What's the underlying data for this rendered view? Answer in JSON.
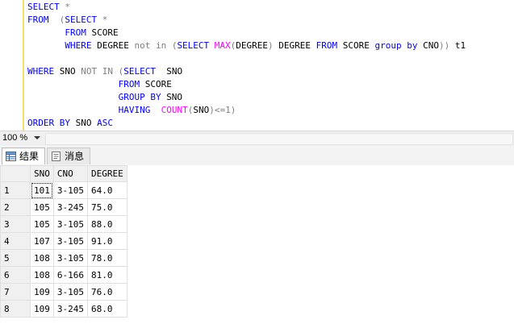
{
  "editor": {
    "lines": [
      [
        {
          "t": "SELECT ",
          "c": "kw"
        },
        {
          "t": "*",
          "c": "op"
        }
      ],
      [
        {
          "t": "FROM  ",
          "c": "kw"
        },
        {
          "t": "(",
          "c": "op"
        },
        {
          "t": "SELECT ",
          "c": "kw"
        },
        {
          "t": "*",
          "c": "op"
        }
      ],
      [
        {
          "t": "       FROM ",
          "c": "kw"
        },
        {
          "t": "SCORE",
          "c": "str"
        }
      ],
      [
        {
          "t": "       WHERE ",
          "c": "kw"
        },
        {
          "t": "DEGREE ",
          "c": "str"
        },
        {
          "t": "not in ",
          "c": "op"
        },
        {
          "t": "(",
          "c": "op"
        },
        {
          "t": "SELECT ",
          "c": "kw"
        },
        {
          "t": "MAX",
          "c": "fn"
        },
        {
          "t": "(",
          "c": "op"
        },
        {
          "t": "DEGREE",
          "c": "str"
        },
        {
          "t": ") ",
          "c": "op"
        },
        {
          "t": "DEGREE ",
          "c": "str"
        },
        {
          "t": "FROM ",
          "c": "kw"
        },
        {
          "t": "SCORE ",
          "c": "str"
        },
        {
          "t": "group by ",
          "c": "kw"
        },
        {
          "t": "CNO",
          "c": "str"
        },
        {
          "t": ")) ",
          "c": "op"
        },
        {
          "t": "t1",
          "c": "str"
        }
      ],
      [],
      [
        {
          "t": "WHERE ",
          "c": "kw"
        },
        {
          "t": "SNO ",
          "c": "str"
        },
        {
          "t": "NOT IN ",
          "c": "op"
        },
        {
          "t": "(",
          "c": "op"
        },
        {
          "t": "SELECT  ",
          "c": "kw"
        },
        {
          "t": "SNO",
          "c": "str"
        }
      ],
      [
        {
          "t": "                 FROM ",
          "c": "kw"
        },
        {
          "t": "SCORE",
          "c": "str"
        }
      ],
      [
        {
          "t": "                 GROUP BY ",
          "c": "kw"
        },
        {
          "t": "SNO",
          "c": "str"
        }
      ],
      [
        {
          "t": "                 HAVING  ",
          "c": "kw"
        },
        {
          "t": "COUNT",
          "c": "fn"
        },
        {
          "t": "(",
          "c": "op"
        },
        {
          "t": "SNO",
          "c": "str"
        },
        {
          "t": ")<=1)",
          "c": "op"
        }
      ],
      [
        {
          "t": "ORDER BY ",
          "c": "kw"
        },
        {
          "t": "SNO ",
          "c": "str"
        },
        {
          "t": "ASC",
          "c": "kw"
        }
      ]
    ]
  },
  "statusbar": {
    "zoom": "100 %"
  },
  "tabs": {
    "results": "结果",
    "messages": "消息"
  },
  "grid": {
    "columns": [
      "SNO",
      "CNO",
      "DEGREE"
    ],
    "rows": [
      [
        "1",
        "101",
        "3-105",
        "64.0"
      ],
      [
        "2",
        "105",
        "3-245",
        "75.0"
      ],
      [
        "3",
        "105",
        "3-105",
        "88.0"
      ],
      [
        "4",
        "107",
        "3-105",
        "91.0"
      ],
      [
        "5",
        "108",
        "3-105",
        "78.0"
      ],
      [
        "6",
        "108",
        "6-166",
        "81.0"
      ],
      [
        "7",
        "109",
        "3-105",
        "76.0"
      ],
      [
        "8",
        "109",
        "3-245",
        "68.0"
      ]
    ]
  },
  "colors": {
    "keyword": "#0000ff",
    "function": "#ff00ff",
    "operator": "#808080",
    "gutter": "#f4e06a"
  }
}
